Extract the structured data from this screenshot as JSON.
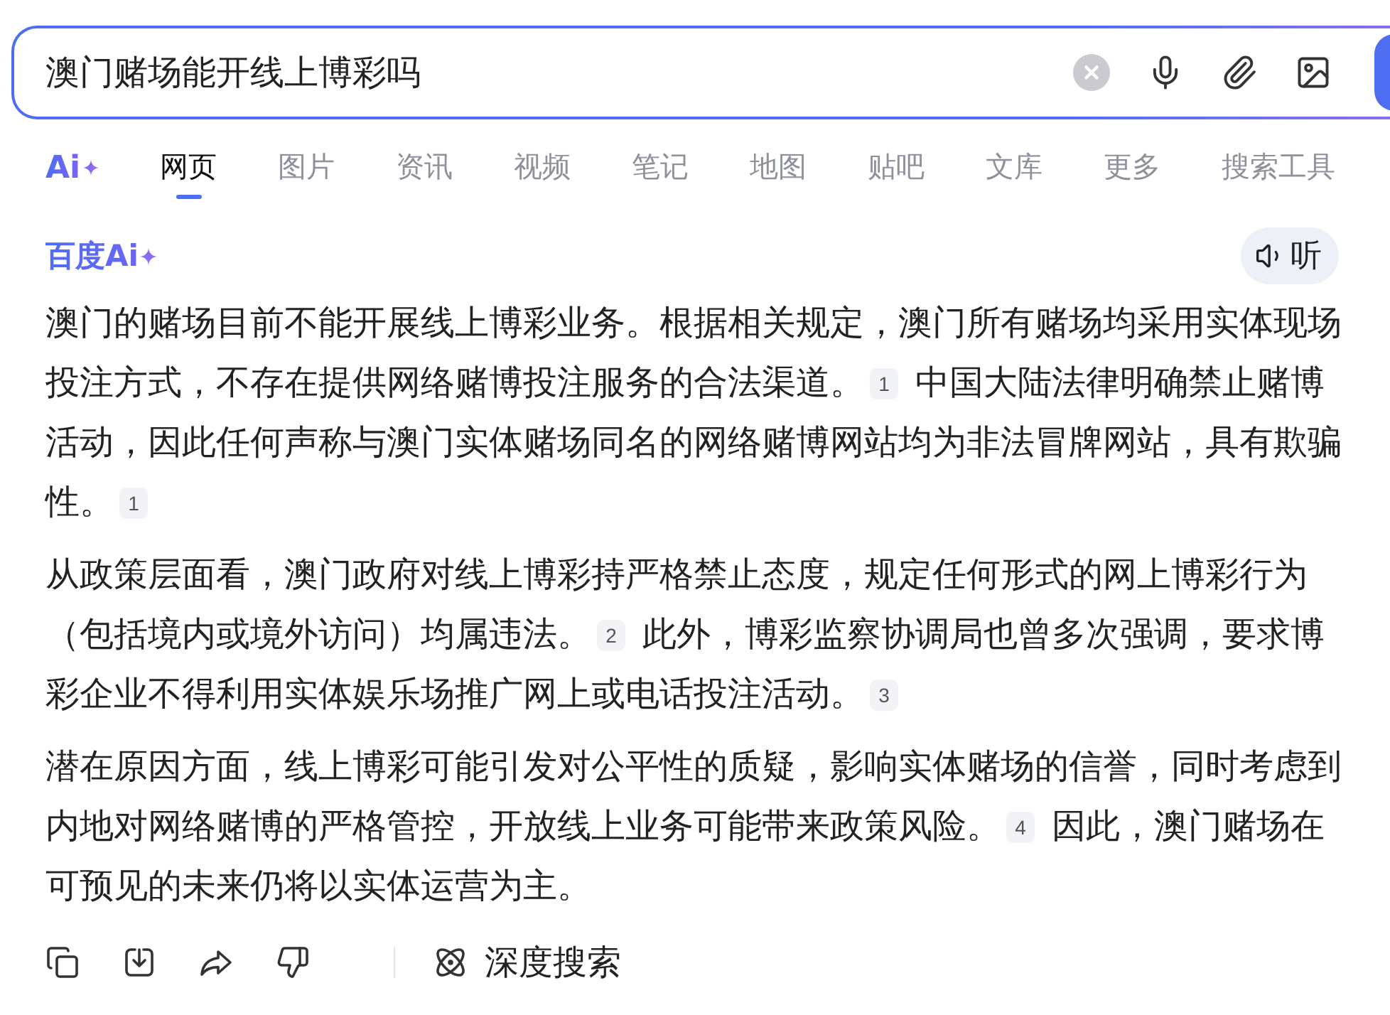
{
  "search": {
    "value": "澳门赌场能开线上博彩吗"
  },
  "tabs": {
    "ai_label": "Ai",
    "items": [
      {
        "label": "网页",
        "selected": true
      },
      {
        "label": "图片",
        "selected": false
      },
      {
        "label": "资讯",
        "selected": false
      },
      {
        "label": "视频",
        "selected": false
      },
      {
        "label": "笔记",
        "selected": false
      },
      {
        "label": "地图",
        "selected": false
      },
      {
        "label": "贴吧",
        "selected": false
      },
      {
        "label": "文库",
        "selected": false
      },
      {
        "label": "更多",
        "selected": false
      },
      {
        "label": "搜索工具",
        "selected": false
      }
    ]
  },
  "answer": {
    "brand": "百度Ai",
    "listen_button": "听",
    "paragraphs": [
      {
        "lines": [
          [
            {
              "kind": "text",
              "text": "澳门的赌场目前不能开展线上博彩业务。根据相关规定，澳门所有赌场均采用实体现场"
            }
          ],
          [
            {
              "kind": "text",
              "text": "投注方式，不存在提供网络赌博投注服务的合法渠道。"
            },
            {
              "kind": "citation",
              "text": "1"
            },
            {
              "kind": "text",
              "text": "中国大陆法律明确禁止赌博"
            }
          ],
          [
            {
              "kind": "text",
              "text": "活动，因此任何声称与澳门实体赌场同名的网络赌博网站均为非法冒牌网站，具有欺骗"
            }
          ],
          [
            {
              "kind": "text",
              "text": "性。"
            },
            {
              "kind": "citation",
              "text": "1"
            }
          ]
        ]
      },
      {
        "lines": [
          [
            {
              "kind": "text",
              "text": "从政策层面看，澳门政府对线上博彩持严格禁止态度，规定任何形式的网上博彩行为"
            }
          ],
          [
            {
              "kind": "text",
              "text": "（包括境内或境外访问）均属违法。"
            },
            {
              "kind": "citation",
              "text": "2"
            },
            {
              "kind": "text",
              "text": "此外，博彩监察协调局也曾多次强调，要求博"
            }
          ],
          [
            {
              "kind": "text",
              "text": "彩企业不得利用实体娱乐场推广网上或电话投注活动。"
            },
            {
              "kind": "citation",
              "text": "3"
            }
          ]
        ]
      },
      {
        "lines": [
          [
            {
              "kind": "text",
              "text": "潜在原因方面，线上博彩可能引发对公平性的质疑，影响实体赌场的信誉，同时考虑到"
            }
          ],
          [
            {
              "kind": "text",
              "text": "内地对网络赌博的严格管控，开放线上业务可能带来政策风险。"
            },
            {
              "kind": "citation",
              "text": "4"
            },
            {
              "kind": "text",
              "text": "因此，澳门赌场在"
            }
          ],
          [
            {
              "kind": "text",
              "text": "可预见的未来仍将以实体运营为主。"
            }
          ]
        ]
      }
    ]
  },
  "actions": {
    "deep_search": "深度搜索"
  }
}
